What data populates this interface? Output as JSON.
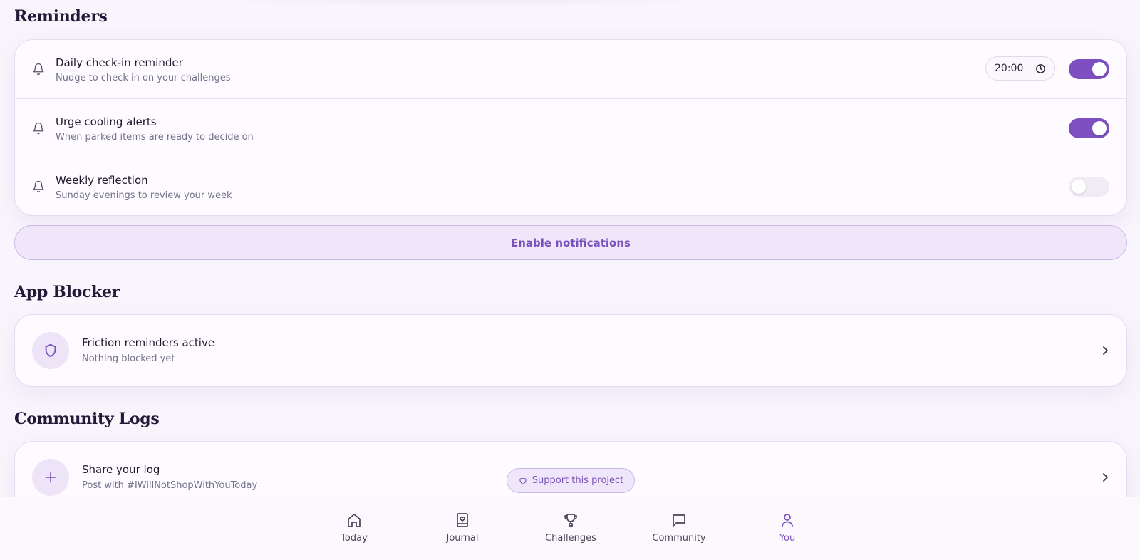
{
  "sections": {
    "reminders": "Reminders",
    "app_blocker": "App Blocker",
    "community_logs": "Community Logs"
  },
  "reminders": [
    {
      "title": "Daily check-in reminder",
      "subtitle": "Nudge to check in on your challenges",
      "time": "20:00",
      "enabled": true
    },
    {
      "title": "Urge cooling alerts",
      "subtitle": "When parked items are ready to decide on",
      "enabled": true
    },
    {
      "title": "Weekly reflection",
      "subtitle": "Sunday evenings to review your week",
      "enabled": false
    }
  ],
  "enable_notifications_label": "Enable notifications",
  "app_blocker": {
    "icon": "shield-icon",
    "title": "Friction reminders active",
    "subtitle": "Nothing blocked yet"
  },
  "community": {
    "icon": "plus-icon",
    "title": "Share your log",
    "subtitle": "Post with #IWillNotShopWithYouToday"
  },
  "support_label": "Support this project",
  "nav": [
    {
      "label": "Today",
      "icon": "home-icon",
      "active": false
    },
    {
      "label": "Journal",
      "icon": "journal-icon",
      "active": false
    },
    {
      "label": "Challenges",
      "icon": "trophy-icon",
      "active": false
    },
    {
      "label": "Community",
      "icon": "chat-icon",
      "active": false
    },
    {
      "label": "You",
      "icon": "user-icon",
      "active": true
    }
  ],
  "colors": {
    "accent": "#7d4fc1",
    "background": "#f8f5fc",
    "card": "#fdfbff"
  }
}
